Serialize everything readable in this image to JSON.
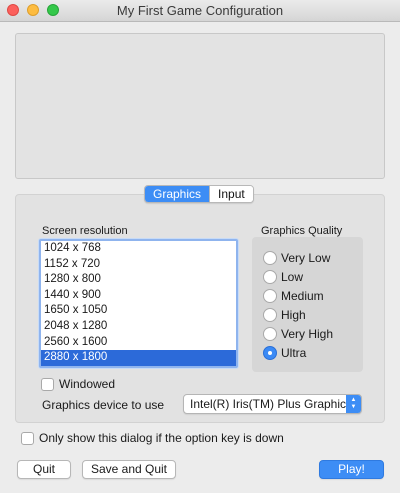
{
  "window": {
    "title": "My First Game Configuration"
  },
  "tabs": [
    {
      "label": "Graphics",
      "active": true
    },
    {
      "label": "Input",
      "active": false
    }
  ],
  "resolution": {
    "label": "Screen resolution",
    "items": [
      "1024 x 768",
      "1152 x 720",
      "1280 x 800",
      "1440 x 900",
      "1650 x 1050",
      "2048 x 1280",
      "2560 x 1600",
      "2880 x 1800"
    ],
    "selected": "2880 x 1800"
  },
  "quality": {
    "label": "Graphics Quality",
    "options": [
      "Very Low",
      "Low",
      "Medium",
      "High",
      "Very High",
      "Ultra"
    ],
    "selected": "Ultra"
  },
  "windowed": {
    "label": "Windowed",
    "checked": false
  },
  "device": {
    "label": "Graphics device to use",
    "value": "Intel(R) Iris(TM) Plus Graphics..."
  },
  "option_key": {
    "label": "Only show this dialog if the option key is down",
    "checked": false
  },
  "buttons": {
    "quit": "Quit",
    "save_quit": "Save and Quit",
    "play": "Play!"
  },
  "colors": {
    "accent": "#3d8df5",
    "selection": "#2c6ad9"
  }
}
